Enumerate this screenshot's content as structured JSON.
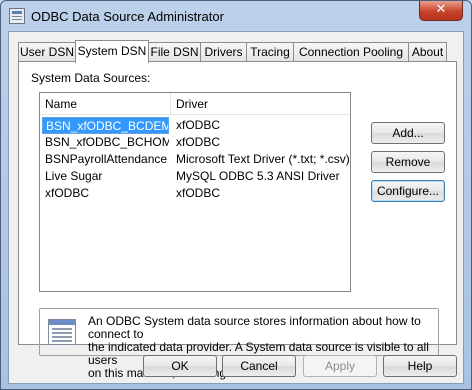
{
  "window": {
    "title": "ODBC Data Source Administrator",
    "close_glyph": "✕"
  },
  "tabs": [
    {
      "label": "User DSN"
    },
    {
      "label": "System DSN"
    },
    {
      "label": "File DSN"
    },
    {
      "label": "Drivers"
    },
    {
      "label": "Tracing"
    },
    {
      "label": "Connection Pooling"
    },
    {
      "label": "About"
    }
  ],
  "active_tab": "System DSN",
  "panel": {
    "section_label": "System Data Sources:",
    "columns": {
      "name": "Name",
      "driver": "Driver"
    },
    "rows": [
      {
        "name": "BSN_xfODBC_BCDEMO",
        "driver": "xfODBC",
        "selected": true
      },
      {
        "name": "BSN_xfODBC_BCHOMES",
        "driver": "xfODBC"
      },
      {
        "name": "BSNPayrollAttendance",
        "driver": "Microsoft Text Driver (*.txt; *.csv)"
      },
      {
        "name": "Live Sugar",
        "driver": "MySQL ODBC 5.3 ANSI Driver"
      },
      {
        "name": "xfODBC",
        "driver": "xfODBC"
      }
    ],
    "buttons": {
      "add": "Add...",
      "remove": "Remove",
      "configure": "Configure..."
    },
    "info": {
      "icon": "database-icon",
      "line1": "An ODBC System data source stores information about how to connect to",
      "line2": "the indicated data provider.  A System data source is visible to all users",
      "line3": "on this machine, including NT services."
    }
  },
  "footer": {
    "ok": "OK",
    "cancel": "Cancel",
    "apply": "Apply",
    "help": "Help"
  }
}
